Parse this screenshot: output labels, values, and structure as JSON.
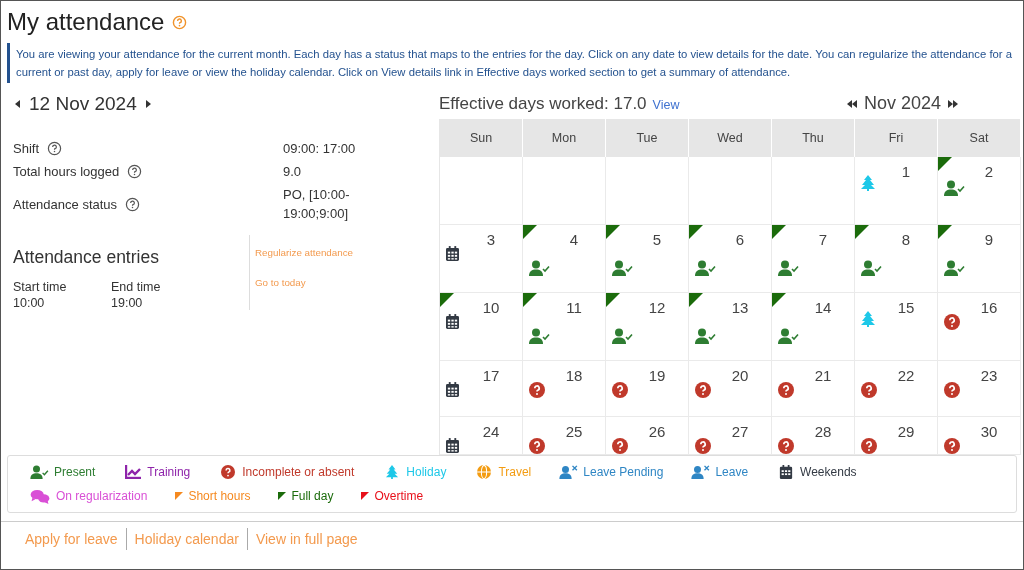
{
  "title": "My attendance",
  "info": "You are viewing your attendance for the current month. Each day has a status that maps to the entries for the day. Click on any date to view details for the date. You can regularize the attendance for a current or past day, apply for leave or view the holiday calendar. Click on View details link in Effective days worked section to get a summary of attendance.",
  "selected_date": "12 Nov 2024",
  "details": [
    {
      "label": "Shift",
      "value": "09:00: 17:00"
    },
    {
      "label": "Total hours logged",
      "value": "9.0"
    },
    {
      "label": "Attendance status",
      "value": "PO, [10:00-19:00;9:00]"
    }
  ],
  "entries": {
    "title": "Attendance entries",
    "columns": [
      "Start time",
      "End time"
    ],
    "rows": [
      [
        "10:00",
        "19:00"
      ]
    ]
  },
  "actions": [
    "Regularize attendance",
    "Go to today"
  ],
  "effective_days": {
    "label": "Effective days worked: 17.0",
    "link": "View"
  },
  "month": "Nov 2024",
  "weekdays": [
    "Sun",
    "Mon",
    "Tue",
    "Wed",
    "Thu",
    "Fri",
    "Sat"
  ],
  "weeks": [
    [
      {
        "kind": "blank"
      },
      {
        "kind": "blank"
      },
      {
        "kind": "blank"
      },
      {
        "kind": "blank"
      },
      {
        "kind": "blank"
      },
      {
        "kind": "holiday",
        "day": "1",
        "full_day": false
      },
      {
        "kind": "present",
        "day": "2",
        "full_day": true
      }
    ],
    [
      {
        "kind": "weekend",
        "day": "3",
        "full_day": false
      },
      {
        "kind": "present",
        "day": "4",
        "full_day": true
      },
      {
        "kind": "present",
        "day": "5",
        "full_day": true
      },
      {
        "kind": "present",
        "day": "6",
        "full_day": true
      },
      {
        "kind": "present",
        "day": "7",
        "full_day": true
      },
      {
        "kind": "present",
        "day": "8",
        "full_day": true
      },
      {
        "kind": "present",
        "day": "9",
        "full_day": true
      }
    ],
    [
      {
        "kind": "weekend",
        "day": "10",
        "full_day": true
      },
      {
        "kind": "present",
        "day": "11",
        "full_day": true
      },
      {
        "kind": "present",
        "day": "12",
        "full_day": true
      },
      {
        "kind": "present",
        "day": "13",
        "full_day": true
      },
      {
        "kind": "present",
        "day": "14",
        "full_day": true
      },
      {
        "kind": "holiday",
        "day": "15",
        "full_day": false
      },
      {
        "kind": "absent",
        "day": "16",
        "full_day": false
      }
    ],
    [
      {
        "kind": "weekend",
        "day": "17",
        "full_day": false
      },
      {
        "kind": "absent",
        "day": "18",
        "full_day": false
      },
      {
        "kind": "absent",
        "day": "19",
        "full_day": false
      },
      {
        "kind": "absent",
        "day": "20",
        "full_day": false
      },
      {
        "kind": "absent",
        "day": "21",
        "full_day": false
      },
      {
        "kind": "absent",
        "day": "22",
        "full_day": false
      },
      {
        "kind": "absent",
        "day": "23",
        "full_day": false
      }
    ],
    [
      {
        "kind": "weekend",
        "day": "24",
        "full_day": false
      },
      {
        "kind": "absent",
        "day": "25",
        "full_day": false
      },
      {
        "kind": "absent",
        "day": "26",
        "full_day": false
      },
      {
        "kind": "absent",
        "day": "27",
        "full_day": false
      },
      {
        "kind": "absent",
        "day": "28",
        "full_day": false
      },
      {
        "kind": "absent",
        "day": "29",
        "full_day": false
      },
      {
        "kind": "absent",
        "day": "30",
        "full_day": false
      }
    ]
  ],
  "legend": [
    [
      {
        "kind": "present",
        "label": "Present",
        "color": "#2e7d32"
      },
      {
        "kind": "training",
        "label": "Training",
        "color": "#8e24aa"
      },
      {
        "kind": "absent",
        "label": "Incomplete or absent",
        "color": "#c0392b"
      },
      {
        "kind": "holiday",
        "label": "Holiday",
        "color": "#1ec8e8"
      },
      {
        "kind": "travel",
        "label": "Travel",
        "color": "#f39c12"
      },
      {
        "kind": "leave_pending",
        "label": "Leave Pending",
        "color": "#2f86c4"
      },
      {
        "kind": "leave",
        "label": "Leave",
        "color": "#2f86c4"
      },
      {
        "kind": "weekend",
        "label": "Weekends",
        "color": "#333a44"
      }
    ],
    [
      {
        "kind": "regularization",
        "label": "On regularization",
        "color": "#d94fd6"
      },
      {
        "kind": "short_hours",
        "label": "Short hours",
        "color": "#f5891f"
      },
      {
        "kind": "full_day",
        "label": "Full day",
        "color": "#1b6b0b"
      },
      {
        "kind": "overtime",
        "label": "Overtime",
        "color": "#e8101a"
      }
    ]
  ],
  "footer_links": [
    "Apply for leave",
    "Holiday calendar",
    "View in full page"
  ]
}
